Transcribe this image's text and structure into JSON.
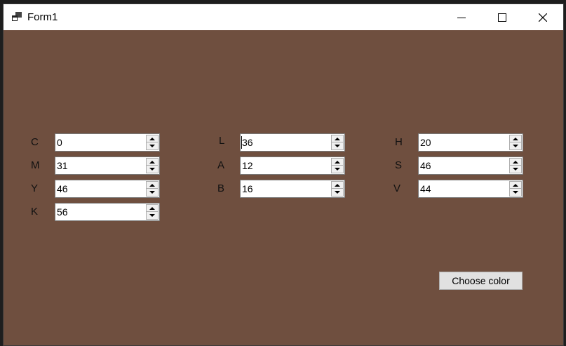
{
  "window": {
    "title": "Form1",
    "background": "#6f4f3f"
  },
  "titlebar_buttons": {
    "minimize": "minimize-icon",
    "maximize": "maximize-icon",
    "close": "close-icon"
  },
  "cmyk": {
    "c": {
      "label": "C",
      "value": "0"
    },
    "m": {
      "label": "M",
      "value": "31"
    },
    "y": {
      "label": "Y",
      "value": "46"
    },
    "k": {
      "label": "K",
      "value": "56"
    }
  },
  "lab": {
    "l": {
      "label": "L",
      "value": "36"
    },
    "a": {
      "label": "A",
      "value": "12"
    },
    "b": {
      "label": "B",
      "value": "16"
    }
  },
  "hsv": {
    "h": {
      "label": "H",
      "value": "20"
    },
    "s": {
      "label": "S",
      "value": "46"
    },
    "v": {
      "label": "V",
      "value": "44"
    }
  },
  "choose_button": "Choose color"
}
